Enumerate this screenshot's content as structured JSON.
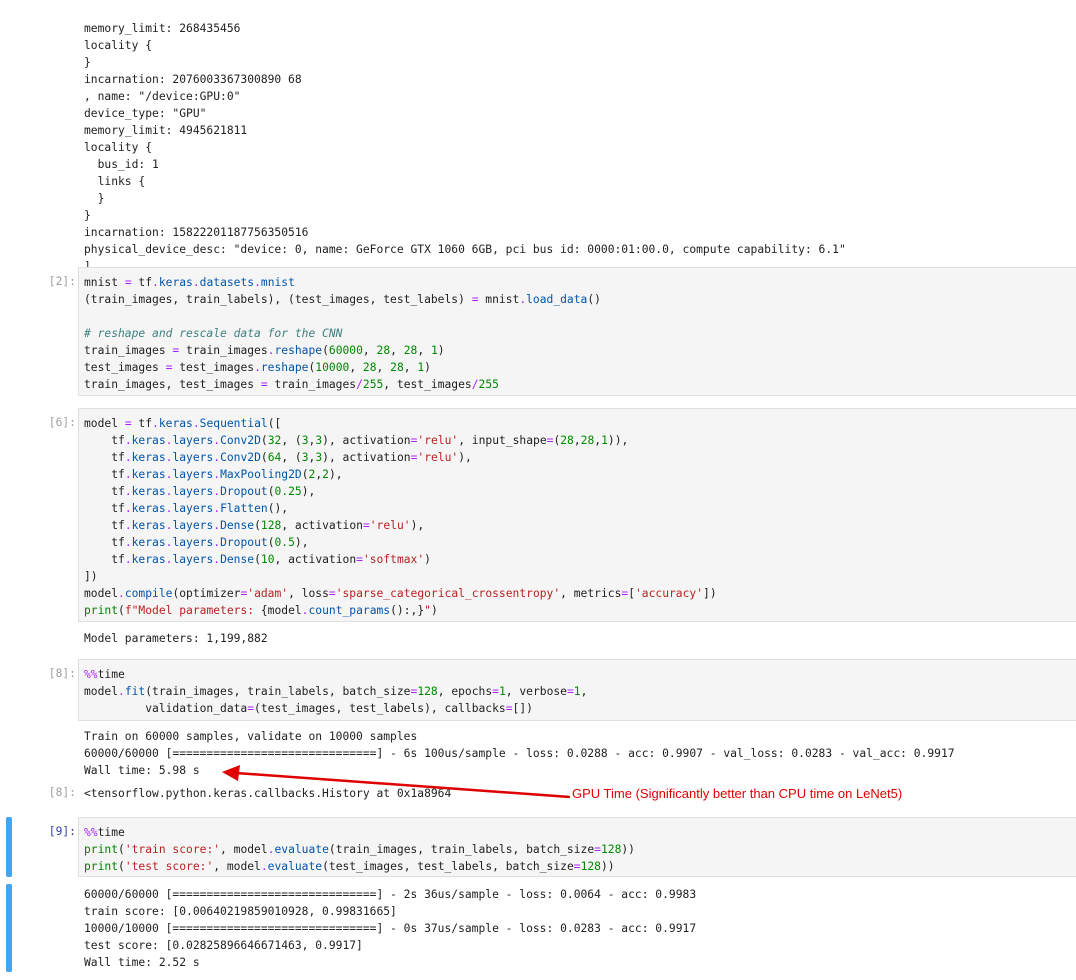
{
  "top_output": [
    "memory_limit: 268435456",
    "locality {",
    "}",
    "incarnation: 2076003367300890​68",
    ", name: \"/device:GPU:0\"",
    "device_type: \"GPU\"",
    "memory_limit: 4945621811",
    "locality {",
    "  bus_id: 1",
    "  links {",
    "  }",
    "}",
    "incarnation: 15822201187756350516",
    "physical_device_desc: \"device: 0, name: GeForce GTX 1060 6GB, pci bus id: 0000:01:00.0, compute capability: 6.1\"",
    "]"
  ],
  "cells": {
    "c2": {
      "prompt": "[2]:"
    },
    "c6": {
      "prompt": "[6]:",
      "output": "Model parameters: 1,199,882"
    },
    "c8": {
      "prompt": "[8]:",
      "output": [
        "Train on 60000 samples, validate on 10000 samples",
        "60000/60000 [==============================] - 6s 100us/sample - loss: 0.0288 - acc: 0.9907 - val_loss: 0.0283 - val_acc: 0.9917",
        "Wall time: 5.98 s"
      ],
      "result_prompt": "[8]:",
      "result": "<tensorflow.python.keras.callbacks.History at 0x1a8964"
    },
    "c9": {
      "prompt": "[9]:",
      "output": [
        "60000/60000 [==============================] - 2s 36us/sample - loss: 0.0064 - acc: 0.9983",
        "train score: [0.00640219859010928, 0.99831665]",
        "10000/10000 [==============================] - 0s 37us/sample - loss: 0.0283 - acc: 0.9917",
        "test score: [0.02825896646671463, 0.9917]",
        "Wall time: 2.52 s"
      ]
    }
  },
  "annotation": {
    "text": "GPU Time (Significantly better than CPU time on LeNet5)",
    "color": "#e00000"
  }
}
